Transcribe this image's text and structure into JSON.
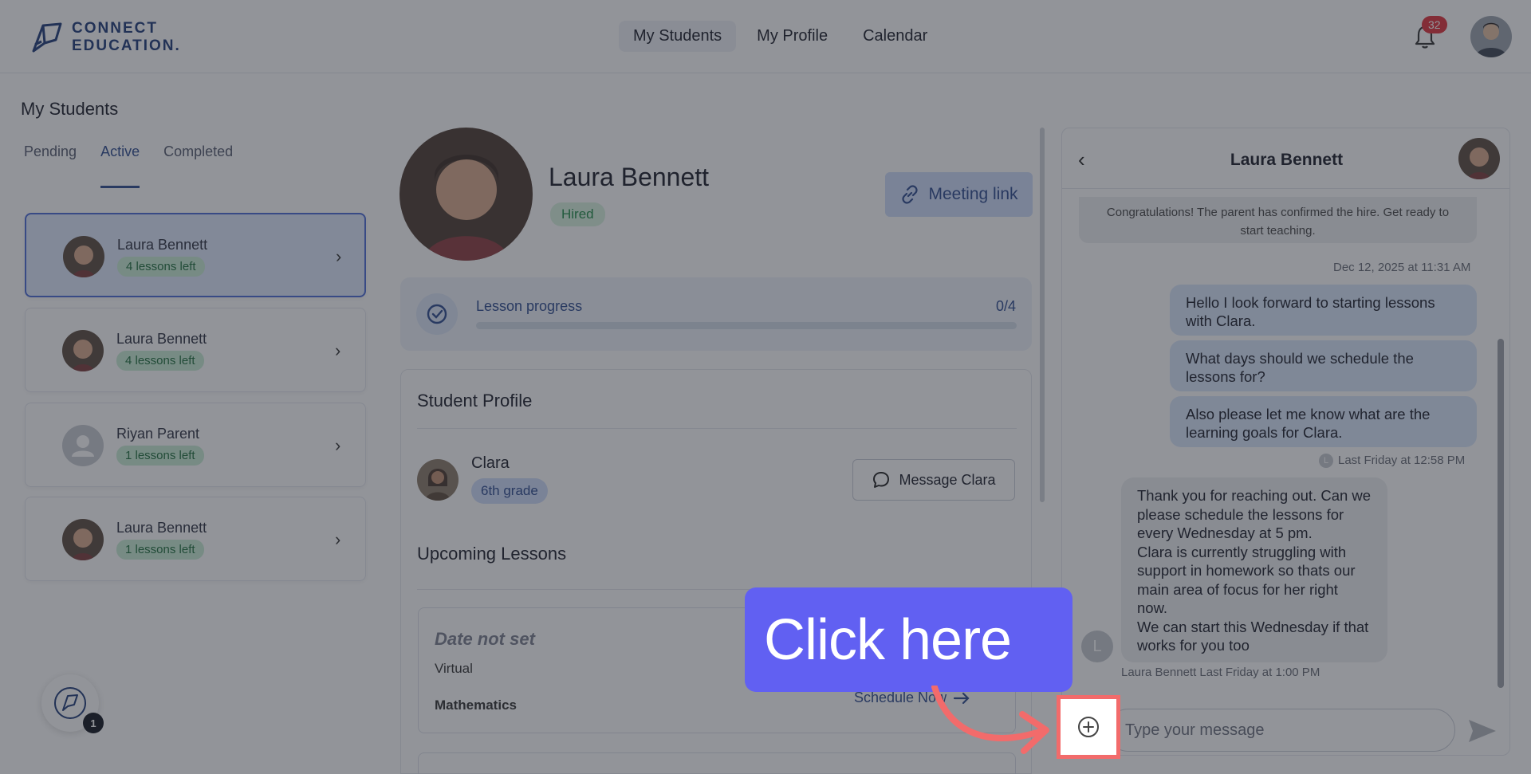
{
  "header": {
    "logo_line1": "CONNECT",
    "logo_line2": "EDUCATION.",
    "nav": [
      "My Students",
      "My Profile",
      "Calendar"
    ],
    "notifications": "32"
  },
  "left": {
    "title": "My Students",
    "tabs": [
      "Pending",
      "Active",
      "Completed"
    ],
    "students": [
      {
        "name": "Laura Bennett",
        "badge": "4 lessons left"
      },
      {
        "name": "Laura Bennett",
        "badge": "4 lessons left"
      },
      {
        "name": "Riyan Parent",
        "badge": "1 lessons left"
      },
      {
        "name": "Laura Bennett",
        "badge": "1 lessons left"
      }
    ],
    "float_count": "1"
  },
  "profile": {
    "name": "Laura Bennett",
    "status": "Hired",
    "meeting_link": "Meeting link",
    "progress_label": "Lesson progress",
    "progress_count": "0/4",
    "progress_fraction": 0,
    "student_profile_title": "Student Profile",
    "child_name": "Clara",
    "child_grade": "6th grade",
    "message_child": "Message Clara",
    "upcoming_title": "Upcoming Lessons",
    "lesson": {
      "date": "Date not set",
      "mode": "Virtual",
      "subject": "Mathematics",
      "schedule": "Schedule Now"
    }
  },
  "chat": {
    "title": "Laura Bennett",
    "system_message": "Congratulations! The parent has confirmed the hire. Get ready to start teaching.",
    "system_ts": "Dec 12, 2025 at 11:31 AM",
    "outgoing": [
      "Hello I look forward to starting lessons with Clara.",
      "What days should we schedule the lessons for?",
      "Also please let me know what are the learning goals for Clara."
    ],
    "outgoing_ts": "Last Friday at 12:58 PM",
    "incoming": "Thank you for reaching out. Can we please schedule the lessons for every Wednesday at 5 pm.\nClara is currently struggling with support in homework so thats our main area of focus for her right now.\nWe can start this Wednesday if that works for you too",
    "incoming_ts": "Laura Bennett Last Friday at 1:00 PM",
    "avatar_initial": "L",
    "input_placeholder": "Type your message"
  },
  "tutorial": {
    "callout": "Click here"
  },
  "colors": {
    "primary": "#2d4a8f",
    "callout_bg": "#6160f2",
    "highlight_border": "#f26b6b",
    "badge_green_bg": "#c9ecd5",
    "notif_red": "#e0313a"
  }
}
